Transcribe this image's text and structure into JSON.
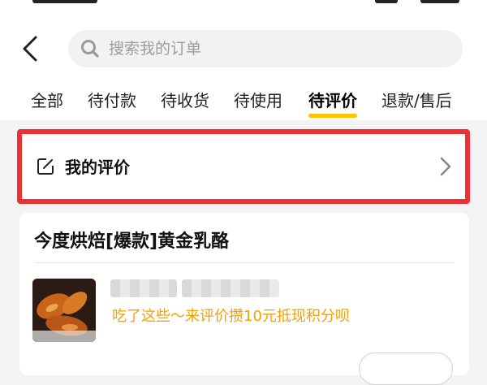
{
  "header": {
    "search_placeholder": "搜索我的订单"
  },
  "tabs": [
    {
      "label": "全部",
      "active": false
    },
    {
      "label": "待付款",
      "active": false
    },
    {
      "label": "待收货",
      "active": false
    },
    {
      "label": "待使用",
      "active": false
    },
    {
      "label": "待评价",
      "active": true
    },
    {
      "label": "退款/售后",
      "active": false
    }
  ],
  "review_entry": {
    "label": "我的评价"
  },
  "order": {
    "shop_name": "今度烘焙[爆款]黄金乳酪",
    "promo_text": "吃了这些～来评价攒10元抵现积分呗"
  },
  "colors": {
    "accent_yellow": "#ffc300",
    "highlight_red": "#ef2f36",
    "promo_orange": "#f5a000"
  }
}
